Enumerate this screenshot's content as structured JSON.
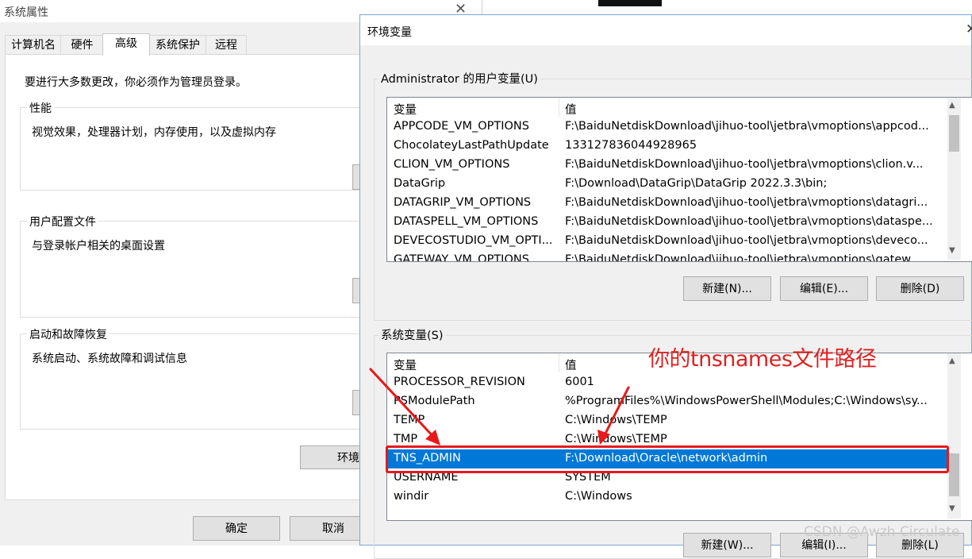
{
  "system_properties": {
    "title": "系统属性",
    "tabs": [
      {
        "label": "计算机名"
      },
      {
        "label": "硬件"
      },
      {
        "label": "高级",
        "active": true
      },
      {
        "label": "系统保护"
      },
      {
        "label": "远程"
      }
    ],
    "admin_hint": "要进行大多数更改，你必须作为管理员登录。",
    "groups": {
      "performance": {
        "title": "性能",
        "desc": "视觉效果，处理器计划，内存使用，以及虚拟内存"
      },
      "user_profiles": {
        "title": "用户配置文件",
        "desc": "与登录帐户相关的桌面设置"
      },
      "startup_recovery": {
        "title": "启动和故障恢复",
        "desc": "系统启动、系统故障和调试信息"
      }
    },
    "env_button_label": "环境",
    "ok_label": "确定",
    "cancel_label": "取消"
  },
  "env_dialog": {
    "title": "环境变量",
    "user_vars": {
      "legend": "Administrator 的用户变量(U)",
      "col_name": "变量",
      "col_value": "值",
      "rows": [
        {
          "name": "APPCODE_VM_OPTIONS",
          "value": "F:\\BaiduNetdiskDownload\\jihuo-tool\\jetbra\\vmoptions\\appcod..."
        },
        {
          "name": "ChocolateyLastPathUpdate",
          "value": "133127836044928965"
        },
        {
          "name": "CLION_VM_OPTIONS",
          "value": "F:\\BaiduNetdiskDownload\\jihuo-tool\\jetbra\\vmoptions\\clion.v..."
        },
        {
          "name": "DataGrip",
          "value": "F:\\Download\\DataGrip\\DataGrip 2022.3.3\\bin;"
        },
        {
          "name": "DATAGRIP_VM_OPTIONS",
          "value": "F:\\BaiduNetdiskDownload\\jihuo-tool\\jetbra\\vmoptions\\datagri..."
        },
        {
          "name": "DATASPELL_VM_OPTIONS",
          "value": "F:\\BaiduNetdiskDownload\\jihuo-tool\\jetbra\\vmoptions\\dataspe..."
        },
        {
          "name": "DEVECOSTUDIO_VM_OPTI...",
          "value": "F:\\BaiduNetdiskDownload\\jihuo-tool\\jetbra\\vmoptions\\deveco..."
        },
        {
          "name": "GATEWAY_VM_OPTIONS",
          "value": "F:\\BaiduNetdiskDownload\\jihuo-tool\\jetbra\\vmoptions\\gatew..."
        }
      ],
      "new_label": "新建(N)...",
      "edit_label": "编辑(E)...",
      "delete_label": "删除(D)"
    },
    "system_vars": {
      "legend": "系统变量(S)",
      "col_name": "变量",
      "col_value": "值",
      "rows": [
        {
          "name": "PROCESSOR_REVISION",
          "value": "6001"
        },
        {
          "name": "PSModulePath",
          "value": "%ProgramFiles%\\WindowsPowerShell\\Modules;C:\\Windows\\sy..."
        },
        {
          "name": "TEMP",
          "value": "C:\\Windows\\TEMP"
        },
        {
          "name": "TMP",
          "value": "C:\\Windows\\TEMP"
        },
        {
          "name": "TNS_ADMIN",
          "value": "F:\\Download\\Oracle\\network\\admin",
          "selected": true
        },
        {
          "name": "USERNAME",
          "value": "SYSTEM"
        },
        {
          "name": "windir",
          "value": "C:\\Windows"
        }
      ],
      "new_label": "新建(W)...",
      "edit_label": "编辑(I)...",
      "delete_label": "删除(L)"
    }
  },
  "annotation": {
    "text": "你的tnsnames文件路径",
    "color": "#e02020"
  },
  "watermark": "CSDN @Awzh Circulate",
  "colors": {
    "selection": "#0078d7",
    "annotation_red": "#e8181b"
  }
}
